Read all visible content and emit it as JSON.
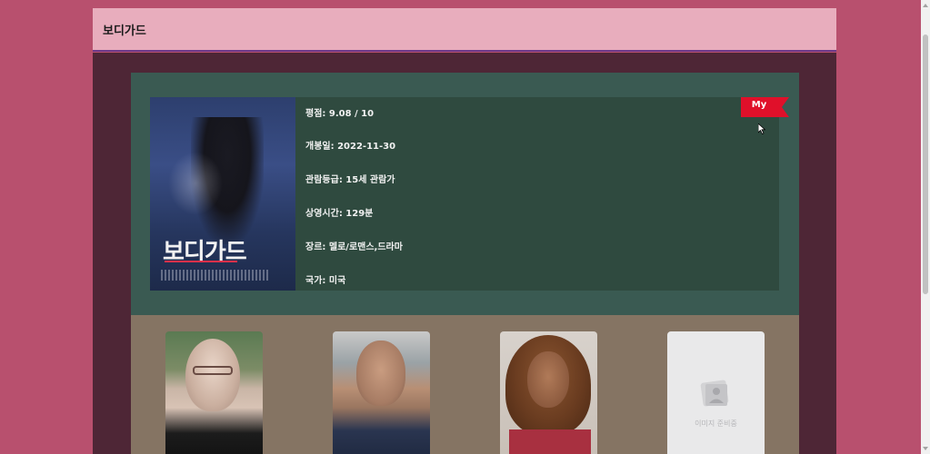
{
  "header": {
    "title": "보디가드"
  },
  "movie": {
    "poster_title": "보디가드",
    "details": [
      {
        "label": "평점",
        "value": "9.08 / 10"
      },
      {
        "label": "개봉일",
        "value": "2022-11-30"
      },
      {
        "label": "관람등급",
        "value": "15세 관람가"
      },
      {
        "label": "상영시간",
        "value": "129분"
      },
      {
        "label": "장르",
        "value": "멜로/로맨스,드라마"
      },
      {
        "label": "국가",
        "value": "미국"
      }
    ],
    "my_button": "My"
  },
  "cast": {
    "placeholder_text": "이미지 준비중",
    "count": 4
  },
  "icons": {
    "my_flag": "bookmark-ribbon-icon",
    "placeholder": "image-placeholder-icon",
    "cursor": "mouse-pointer-icon"
  },
  "colors": {
    "background": "#b8506e",
    "header": "#e8adbd",
    "main": "#4e2636",
    "info_panel": "#3a5a52",
    "info_inner": "#2f4a3f",
    "cast_panel": "#857463",
    "my_flag": "#e0102a"
  }
}
